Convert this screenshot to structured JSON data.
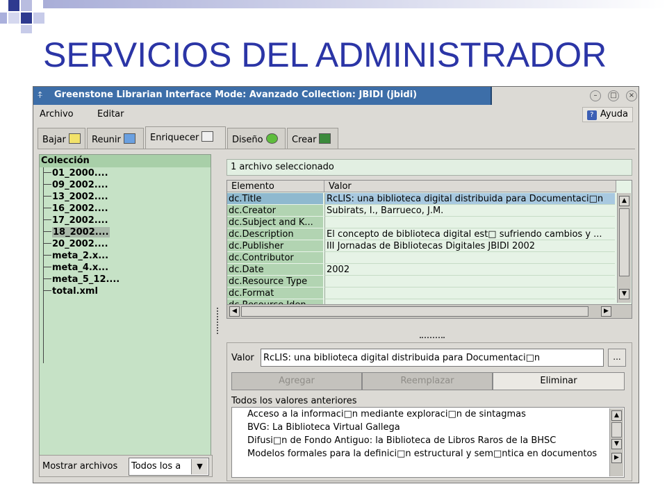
{
  "slide": {
    "title": "SERVICIOS DEL ADMINISTRADOR"
  },
  "window": {
    "title": "Greenstone Librarian Interface  Mode: Avanzado  Collection: JBIDI (jbidi)",
    "window_icon": "pin-icon"
  },
  "menu": {
    "file": "Archivo",
    "edit": "Editar",
    "help": "Ayuda"
  },
  "tabs": [
    {
      "label": "Bajar",
      "icon": "download-icon"
    },
    {
      "label": "Reunir",
      "icon": "gather-icon"
    },
    {
      "label": "Enriquecer",
      "icon": "enrich-icon"
    },
    {
      "label": "Diseño",
      "icon": "gear-icon"
    },
    {
      "label": "Crear",
      "icon": "build-icon"
    }
  ],
  "collection": {
    "header": "Colección",
    "items": [
      "01_2000....",
      "09_2002....",
      "13_2002....",
      "16_2002....",
      "17_2002....",
      "18_2002....",
      "20_2002....",
      "meta_2.x...",
      "meta_4.x...",
      "meta_5_12....",
      "total.xml"
    ],
    "selected_index": 5
  },
  "filter": {
    "label": "Mostrar archivos",
    "value": "Todos los a"
  },
  "selection_status": "1 archivo seleccionado",
  "metadata_table": {
    "columns": [
      "Elemento",
      "Valor"
    ],
    "rows": [
      {
        "element": "dc.Title",
        "value": "RcLIS: una biblioteca digital distribuida para Documentaci□n"
      },
      {
        "element": "dc.Creator",
        "value": "Subirats, I., Barrueco, J.M."
      },
      {
        "element": "dc.Subject and K...",
        "value": ""
      },
      {
        "element": "dc.Description",
        "value": "El concepto de biblioteca digital est□ sufriendo cambios y ..."
      },
      {
        "element": "dc.Publisher",
        "value": "III Jornadas de Bibliotecas Digitales JBIDI 2002"
      },
      {
        "element": "dc.Contributor",
        "value": ""
      },
      {
        "element": "dc.Date",
        "value": "2002"
      },
      {
        "element": "dc.Resource Type",
        "value": ""
      },
      {
        "element": "dc.Format",
        "value": ""
      },
      {
        "element": "dc.Resource Iden...",
        "value": ""
      }
    ],
    "selected_index": 0
  },
  "editor": {
    "value_label": "Valor",
    "value": "RcLIS: una biblioteca digital distribuida para Documentaci□n",
    "browse": "...",
    "add": "Agregar",
    "replace": "Reemplazar",
    "remove": "Eliminar",
    "previous_label": "Todos los valores anteriores",
    "previous_values": [
      "Acceso a la informaci□n mediante exploraci□n de sintagmas",
      "BVG: La Biblioteca Virtual Gallega",
      "Difusi□n de Fondo Antiguo: la Biblioteca de Libros Raros de la BHSC",
      "Modelos formales para la definici□n estructural y sem□ntica en documentos"
    ]
  },
  "colors": {
    "title_text": "#2b35a6",
    "titlebar": "#3d6ea8",
    "panel_green": "#c6e2c6",
    "selected_row": "#a8c9e0"
  }
}
